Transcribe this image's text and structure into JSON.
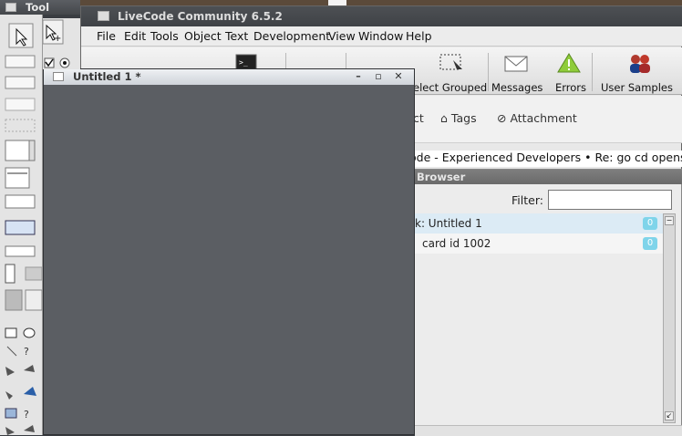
{
  "main_window": {
    "title": "LiveCode Community 6.5.2"
  },
  "menubar": {
    "items": [
      "File",
      "Edit",
      "Tools",
      "Object",
      "Text",
      "Development",
      "View",
      "Window",
      "Help"
    ]
  },
  "toolbar": {
    "buttons": [
      {
        "label": "elect Grouped",
        "icon": "select-grouped-icon"
      },
      {
        "label": "Messages",
        "icon": "envelope-icon"
      },
      {
        "label": "Errors",
        "icon": "warning-icon"
      },
      {
        "label": "User Samples",
        "icon": "users-icon"
      }
    ]
  },
  "forum": {
    "tabs": [
      "ct",
      "Tags",
      "Attachment"
    ],
    "status_line": "ode - Experienced Developers • Re: go cd opens n"
  },
  "browser": {
    "title": "Browser",
    "filter_label": "Filter:",
    "filter_value": "",
    "rows": [
      {
        "label": "k: Untitled 1",
        "count": "0",
        "selected": true
      },
      {
        "label": "card id 1002",
        "count": "0",
        "selected": false
      }
    ]
  },
  "stack_window": {
    "title": "Untitled 1 *"
  },
  "tools": {
    "title": "Tool"
  },
  "colors": {
    "accent": "#7fd4ea",
    "selected_row": "#dcebf5",
    "stack_bg": "#5b5e63"
  }
}
